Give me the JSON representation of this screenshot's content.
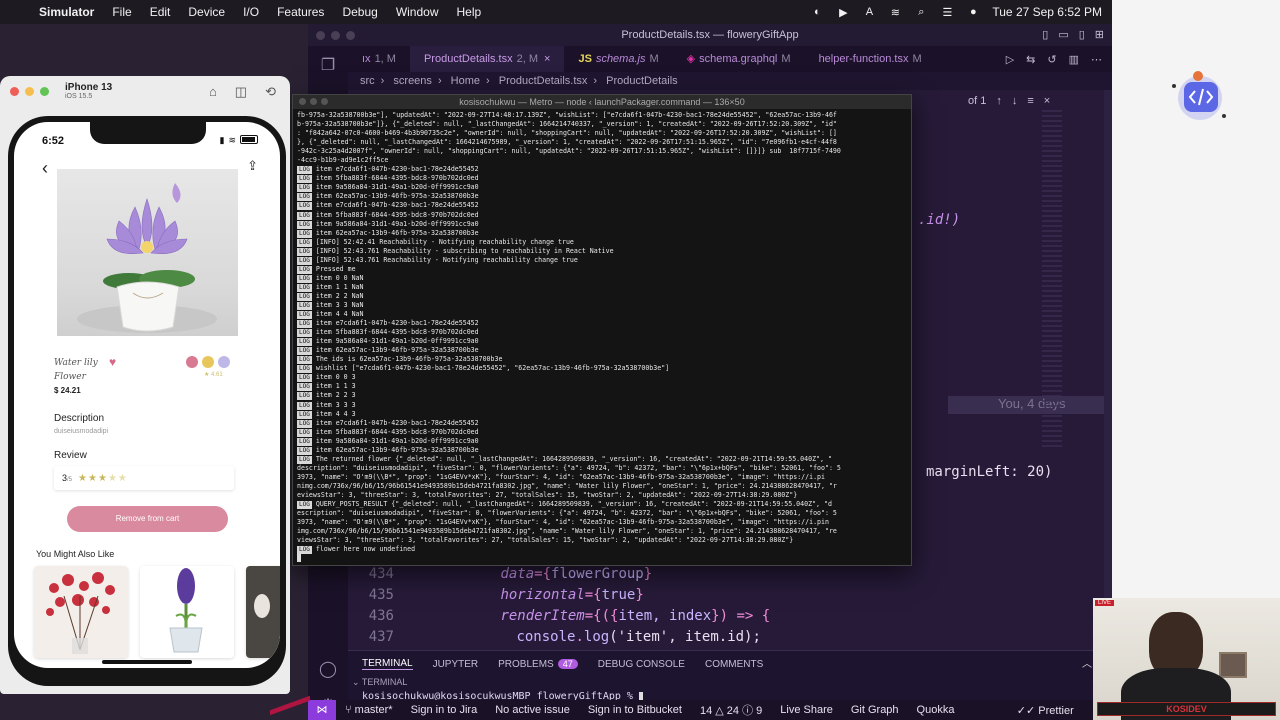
{
  "menubar": {
    "app": "Simulator",
    "items": [
      "File",
      "Edit",
      "Device",
      "I/O",
      "Features",
      "Debug",
      "Window",
      "Help"
    ],
    "clock": "Tue 27 Sep  6:52 PM"
  },
  "vscode": {
    "title": "ProductDetails.tsx — floweryGiftApp",
    "tabs": [
      {
        "icon": "",
        "label": "ıx",
        "mod": "1, M"
      },
      {
        "icon": "TS",
        "label": "ProductDetails.tsx",
        "mod": "2, M"
      },
      {
        "icon": "JS",
        "label": "schema.js",
        "mod": "M"
      },
      {
        "icon": "◈",
        "label": "schema.graphql",
        "mod": "M"
      },
      {
        "icon": "TS",
        "label": "helper-function.tsx",
        "mod": "M"
      }
    ],
    "breadcrumb": [
      "src",
      "screens",
      "Home",
      "ProductDetails.tsx",
      "ProductDetails"
    ],
    "find_count": "of 1",
    "snippet_id": ".id!)",
    "snippet_margin": "marginLeft: 20)",
    "blame": "You, 4 days",
    "code_lines": [
      {
        "num": "434",
        "indent": "      ",
        "a": "data",
        "b": "={",
        "c": "flowerGroup",
        "d": "}"
      },
      {
        "num": "435",
        "indent": "      ",
        "a": "horizontal",
        "b": "={",
        "c": "true",
        "d": "}"
      },
      {
        "num": "436",
        "indent": "      ",
        "a": "renderItem",
        "b": "={({",
        "c": "item, index",
        "d": "}) => {"
      },
      {
        "num": "437",
        "indent": "        ",
        "a": "console",
        "b": ".",
        "c": "log",
        "d": "('item', item.id);"
      }
    ],
    "panel": {
      "tabs": [
        "TERMINAL",
        "JUPYTER",
        "PROBLEMS",
        "DEBUG CONSOLE",
        "COMMENTS"
      ],
      "problems_count": "47",
      "terminal_label": "TERMINAL",
      "prompt": "kosisochukwu@kosisocukwusMBP floweryGiftApp % "
    },
    "status": {
      "branch": "master*",
      "left_items": [
        "Sign in to Jira",
        "No active issue",
        "Sign in to Bitbucket",
        "14 △ 24 ⓘ 9",
        "Live Share",
        "Git Graph",
        "Quokka"
      ],
      "right_items": [
        "Prettier"
      ]
    }
  },
  "metro": {
    "title": "kosisochukwu — Metro — node ‹ launchPackager.command — 136×50",
    "lines": [
      {
        "tag": "",
        "text": "fb-975a-32a538700b3e\"], \"updatedAt\": \"2022-09-27T14:48:17.139Z\", \"wishList\": [\"e7cda6f1-047b-4230-bac1-78e24de55452\", \"62ea57ac-13b9-46f"
      },
      {
        "tag": "",
        "text": "b-975a-32a538700b3e\"]}, {\"_deleted\": null, \"_lastChangedAt\": 1664214740337, \"_version\": 1, \"createdAt\": \"2022-09-26T17:52:20.309Z\", \"id\""
      },
      {
        "tag": "",
        "text": ": \"f842a642-07c0-4600-b469-4b3b90735c2e\", \"ownerId\": null, \"shoppingCart\": null, \"updatedAt\": \"2022-09-26T17:52:20.309Z\", \"wishList\": []"
      },
      {
        "tag": "",
        "text": "}, {\"_deleted\": null, \"_lastChangedAt\": 1664214675989, \"_version\": 1, \"createdAt\": \"2022-09-26T17:51:15.965Z\", \"id\": \"7e096fb1-e4cf-44f8"
      },
      {
        "tag": "",
        "text": "-942c-3c25a4d2007f\", \"ownerId\": null, \"shoppingCart\": null, \"updatedAt\": \"2022-09-26T17:51:15.965Z\", \"wishList\": []}]} sub  18f7715f-7490"
      },
      {
        "tag": "",
        "text": "-4cc9-b1b9-ad9e1c2ff5ce"
      },
      {
        "tag": "LOG",
        "text": "item e7cda6f1-047b-4230-bac1-78e24de55452"
      },
      {
        "tag": "LOG",
        "text": "item 5fba883f-6844-4395-bdc8-970b702dc0ed"
      },
      {
        "tag": "LOG",
        "text": "item 9a586a84-31d1-49a1-b20d-0ff9991cc9a0"
      },
      {
        "tag": "LOG",
        "text": "item 62ea57ac-13b9-46fb-975a-32a538700b3e"
      },
      {
        "tag": "LOG",
        "text": "item e7cda6f1-047b-4230-bac1-78e24de55452"
      },
      {
        "tag": "LOG",
        "text": "item 5fba883f-6844-4395-bdc8-970b702dc0ed"
      },
      {
        "tag": "LOG",
        "text": "item 9a586a84-31d1-49a1-b20d-0ff9991cc9a0"
      },
      {
        "tag": "LOG",
        "text": "item 62ea57ac-13b9-46fb-975a-32a538700b3e"
      },
      {
        "tag": "LOG",
        "text": "[INFO] 52:42.41 Reachability - Notifying reachability change true"
      },
      {
        "tag": "LOG",
        "text": "[INFO] 52:43.761 Reachability - subscribing to reachability in React Native"
      },
      {
        "tag": "LOG",
        "text": "[INFO] 52:43.761 Reachability - Notifying reachability change true"
      },
      {
        "tag": "LOG",
        "text": "Pressed me"
      },
      {
        "tag": "LOG",
        "text": "item 0 0 NaN"
      },
      {
        "tag": "LOG",
        "text": "item 1 1 NaN"
      },
      {
        "tag": "LOG",
        "text": "item 2 2 NaN"
      },
      {
        "tag": "LOG",
        "text": "item 3 3 NaN"
      },
      {
        "tag": "LOG",
        "text": "item 4 4 NaN"
      },
      {
        "tag": "LOG",
        "text": "item e7cda6f1-047b-4230-bac1-78e24de55452"
      },
      {
        "tag": "LOG",
        "text": "item 5fba883f-6844-4395-bdc8-970b702dc0ed"
      },
      {
        "tag": "LOG",
        "text": "item 9a586a84-31d1-49a1-b20d-0ff9991cc9a0"
      },
      {
        "tag": "LOG",
        "text": "item 62ea57ac-13b9-46fb-975a-32a538700b3e"
      },
      {
        "tag": "LOG",
        "text": "The ids is 62ea57ac-13b9-46fb-975a-32a538700b3e"
      },
      {
        "tag": "LOG",
        "text": "wishlist [\"e7cda6f1-047b-4230-bac1-78e24de55452\", \"62ea57ac-13b9-46fb-975a-32a538700b3e\"]"
      },
      {
        "tag": "LOG",
        "text": "item 0 0 3"
      },
      {
        "tag": "LOG",
        "text": "item 1 1 3"
      },
      {
        "tag": "LOG",
        "text": "item 2 2 3"
      },
      {
        "tag": "LOG",
        "text": "item 3 3 3"
      },
      {
        "tag": "LOG",
        "text": "item 4 4 3"
      },
      {
        "tag": "LOG",
        "text": "item e7cda6f1-047b-4230-bac1-78e24de55452"
      },
      {
        "tag": "LOG",
        "text": "item 5fba883f-6844-4395-bdc8-970b702dc0ed"
      },
      {
        "tag": "LOG",
        "text": "item 9a586a84-31d1-49a1-b20d-0ff9991cc9a0"
      },
      {
        "tag": "LOG",
        "text": "item 62ea57ac-13b9-46fb-975a-32a538700b3e"
      },
      {
        "tag": "LOG",
        "text": "The returned flower {\"_deleted\": null, \"_lastChangedAt\": 1664289509839, \"_version\": 16, \"createdAt\": \"2022-09-21T14:59:55.040Z\", \""
      },
      {
        "tag": "",
        "text": "description\": \"duiseiusmodadipi\", \"fiveStar\": 0, \"flowerVarients\": {\"a\": 49724, \"b\": 42372, \"bar\": \"\\\"6p1x+bQFs\", \"bike\": 52061, \"foo\": 5"
      },
      {
        "tag": "",
        "text": "3973, \"name\": \"O'm9(\\\\B*\", \"prop\": \"1sG4EVv*xK\"}, \"fourStar\": 4, \"id\": \"62ea57ac-13b9-46fb-975a-32a538700b3e\", \"image\": \"https://i.pi"
      },
      {
        "tag": "",
        "text": "nimg.com/736x/96/b6/15/96b61541e9493589b15deb4721fa8302.jpg\", \"name\": \"Water lily Flower\", \"oneStar\": 1, \"price\": 24.214388628470417, \"r"
      },
      {
        "tag": "",
        "text": "eviewsStar\": 3, \"threeStar\": 3, \"totalFavorites\": 27, \"totalSales\": 15, \"twoStar\": 2, \"updatedAt\": \"2022-09-27T14:38:29.080Z\"}"
      },
      {
        "tag": "LOG",
        "text": "QUERY_POSTS_RESULT {\"_deleted\": null, \"_lastChangedAt\": 1664289509839, \"_version\": 16, \"createdAt\": \"2022-09-21T14:59:55.040Z\", \"d"
      },
      {
        "tag": "",
        "text": "escription\": \"duiseiusmodadipi\", \"fiveStar\": 0, \"flowerVarients\": {\"a\": 49724, \"b\": 42372, \"bar\": \"\\\"6p1x+bQFs\", \"bike\": 52061, \"foo\": 5"
      },
      {
        "tag": "",
        "text": "3973, \"name\": \"O'm9(\\\\B*\", \"prop\": \"1sG4EVv*xK\"}, \"fourStar\": 4, \"id\": \"62ea57ac-13b9-46fb-975a-32a538700b3e\", \"image\": \"https://i.pin"
      },
      {
        "tag": "",
        "text": "img.com/736x/96/b6/15/96b61541e9493589b15deb4721fa8302.jpg\", \"name\": \"Water lily Flower\", \"oneStar\": 1, \"price\": 24.214388628470417, \"re"
      },
      {
        "tag": "",
        "text": "viewsStar\": 3, \"threeStar\": 3, \"totalFavorites\": 27, \"totalSales\": 15, \"twoStar\": 2, \"updatedAt\": \"2022-09-27T14:38:29.080Z\"}"
      },
      {
        "tag": "LOG",
        "text": "flower here now undefined"
      }
    ]
  },
  "simulator": {
    "device_name": "iPhone 13",
    "os": "iOS 15.5",
    "time": "6:52",
    "product": {
      "name_line1": "Water lily",
      "name_line2": "Flower",
      "price": "$ 24.21",
      "rating_small": "4.61"
    },
    "description_label": "Description",
    "description": "duiseiusmodadipi",
    "review_label": "Review",
    "review_score": "3",
    "review_scale": "/5",
    "remove_button": "Remove from cart",
    "also_like": "You Might Also Like",
    "colors": [
      "#d97a93",
      "#e7c75c",
      "#bdb8e8"
    ]
  },
  "webcam": {
    "brand": "KOSIDEV",
    "live": "LIVE"
  }
}
